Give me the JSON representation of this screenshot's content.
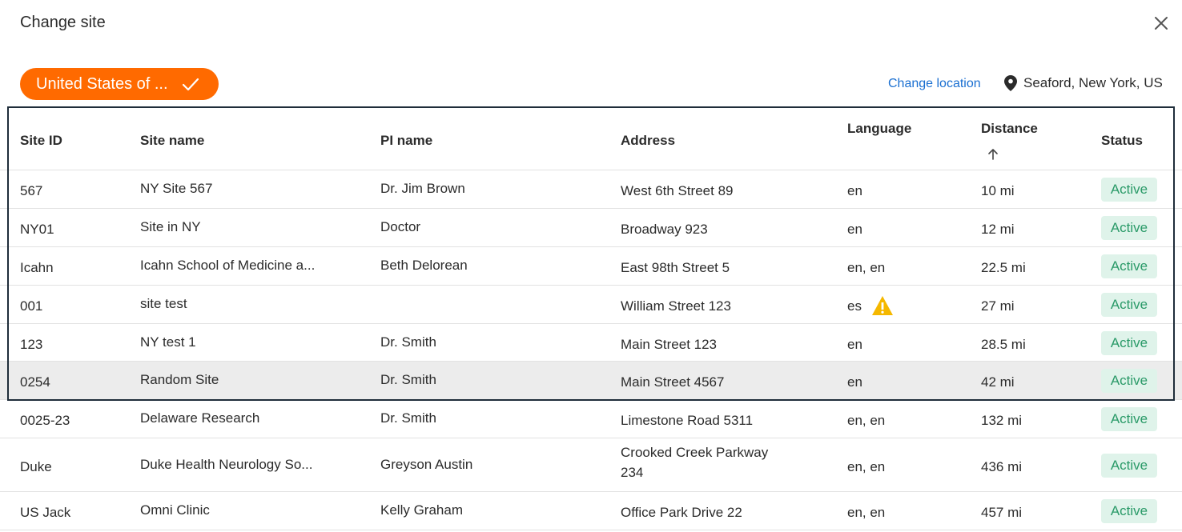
{
  "dialog": {
    "title": "Change site"
  },
  "filter_chip": {
    "label": "United States of ..."
  },
  "location": {
    "change_label": "Change location",
    "current": "Seaford, New York, US"
  },
  "table": {
    "columns": {
      "site_id": "Site ID",
      "site_name": "Site name",
      "pi_name": "PI name",
      "address": "Address",
      "language": "Language",
      "distance": "Distance",
      "status": "Status"
    },
    "rows": [
      {
        "site_id": "567",
        "site_name": "NY Site 567",
        "pi_name": "Dr. Jim Brown",
        "address_1": "West 6th Street 89",
        "address_2": "",
        "language": "en",
        "warning": false,
        "distance": "10 mi",
        "status": "Active"
      },
      {
        "site_id": "NY01",
        "site_name": "Site in NY",
        "pi_name": "Doctor",
        "address_1": "Broadway 923",
        "address_2": "",
        "language": "en",
        "warning": false,
        "distance": "12 mi",
        "status": "Active"
      },
      {
        "site_id": "Icahn",
        "site_name": "Icahn School of Medicine a...",
        "pi_name": "Beth Delorean",
        "address_1": "East 98th Street 5",
        "address_2": "",
        "language": "en, en",
        "warning": false,
        "distance": "22.5 mi",
        "status": "Active"
      },
      {
        "site_id": "001",
        "site_name": "site test",
        "pi_name": "",
        "address_1": "William Street 123",
        "address_2": "",
        "language": "es",
        "warning": true,
        "distance": "27 mi",
        "status": "Active"
      },
      {
        "site_id": "123",
        "site_name": "NY test 1",
        "pi_name": "Dr. Smith",
        "address_1": "Main Street 123",
        "address_2": "",
        "language": "en",
        "warning": false,
        "distance": "28.5 mi",
        "status": "Active"
      },
      {
        "site_id": "0254",
        "site_name": "Random Site",
        "pi_name": "Dr. Smith",
        "address_1": "Main Street 4567",
        "address_2": "",
        "language": "en",
        "warning": false,
        "distance": "42 mi",
        "status": "Active"
      },
      {
        "site_id": "0025-23",
        "site_name": "Delaware Research",
        "pi_name": "Dr. Smith",
        "address_1": "Limestone Road 5311",
        "address_2": "",
        "language": "en, en",
        "warning": false,
        "distance": "132 mi",
        "status": "Active"
      },
      {
        "site_id": "Duke",
        "site_name": "Duke Health Neurology So...",
        "pi_name": "Greyson Austin",
        "address_1": "Crooked Creek Parkway",
        "address_2": "234",
        "language": "en, en",
        "warning": false,
        "distance": "436 mi",
        "status": "Active"
      },
      {
        "site_id": "US Jack",
        "site_name": "Omni Clinic",
        "pi_name": "Kelly Graham",
        "address_1": "Office Park Drive 22",
        "address_2": "",
        "language": "en, en",
        "warning": false,
        "distance": "457 mi",
        "status": "Active"
      }
    ]
  },
  "colors": {
    "accent": "#ff6a00",
    "link": "#1a6fd1",
    "badge_bg": "#dff3ea",
    "badge_text": "#2a9a68",
    "warning": "#f5b800"
  }
}
